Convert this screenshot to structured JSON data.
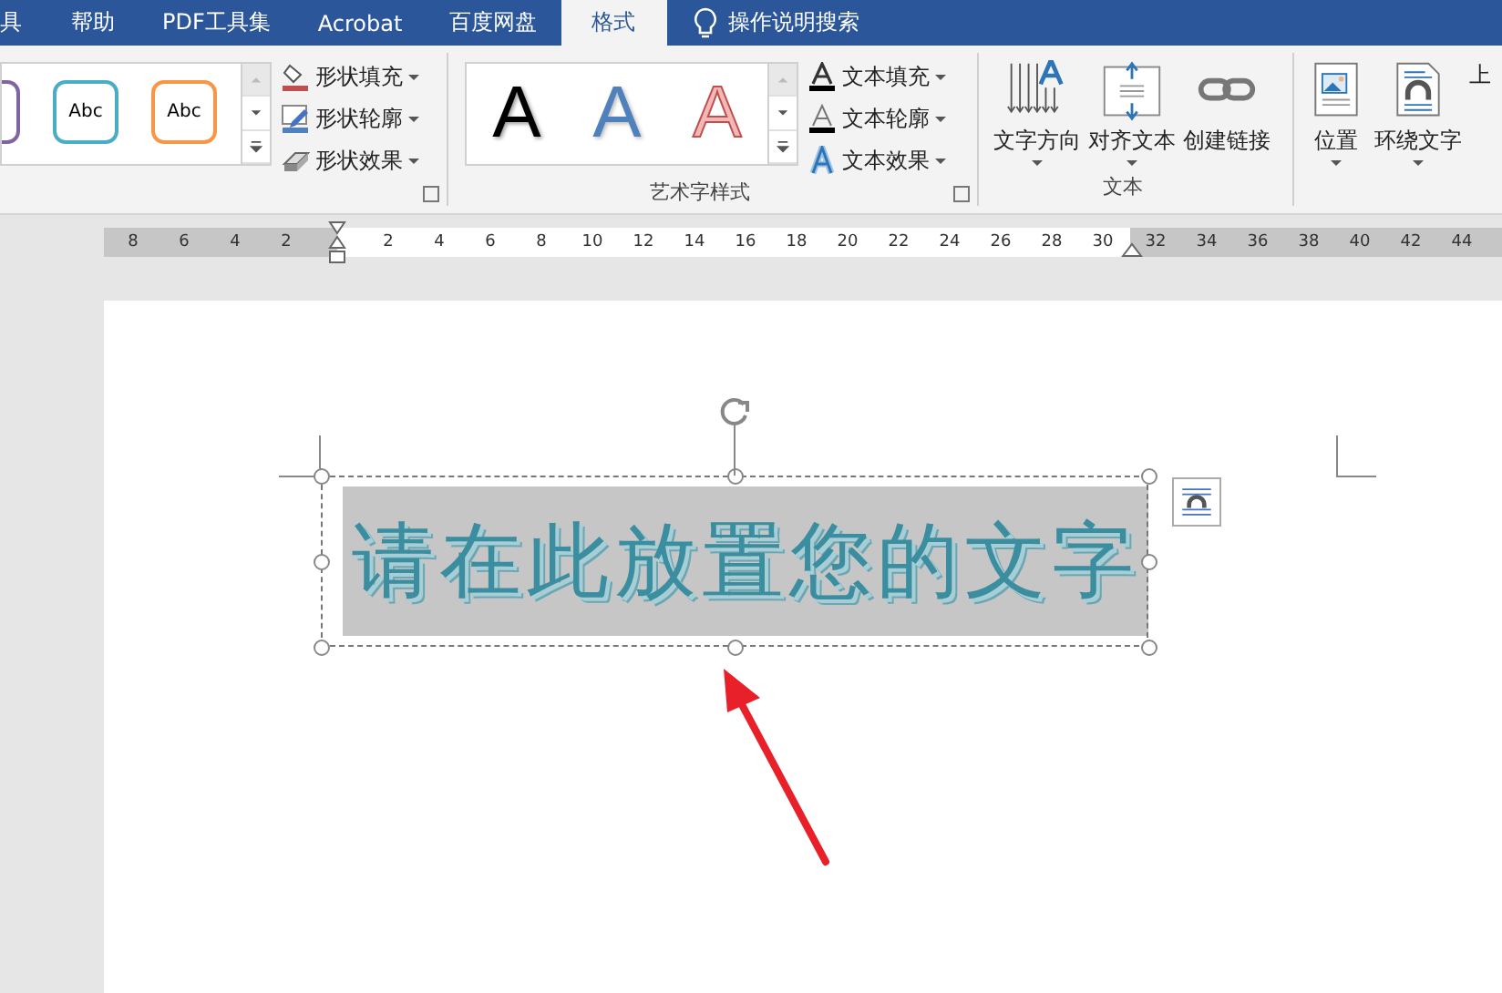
{
  "tabs": [
    {
      "label": "具",
      "selected": false
    },
    {
      "label": "帮助",
      "selected": false
    },
    {
      "label": "PDF工具集",
      "selected": false
    },
    {
      "label": "Acrobat",
      "selected": false
    },
    {
      "label": "百度网盘",
      "selected": false
    },
    {
      "label": "格式",
      "selected": true
    }
  ],
  "tell_me": "操作说明搜索",
  "shape_styles": {
    "swatches": [
      {
        "color": "#8064a2"
      },
      {
        "label": "Abc",
        "color": "#4bacc6"
      },
      {
        "label": "Abc",
        "color": "#f79646"
      }
    ],
    "commands": [
      {
        "kind": "fill",
        "label": "形状填充"
      },
      {
        "kind": "outline",
        "label": "形状轮廓"
      },
      {
        "kind": "effects",
        "label": "形状效果"
      }
    ]
  },
  "wordart_styles": {
    "label": "艺术字样式",
    "presets": [
      {
        "kind": "black",
        "label": "A"
      },
      {
        "kind": "blue",
        "label": "A"
      },
      {
        "kind": "red-outline",
        "label": "A"
      }
    ],
    "commands": [
      {
        "kind": "fill",
        "label": "文本填充"
      },
      {
        "kind": "outline",
        "label": "文本轮廓"
      },
      {
        "kind": "effects",
        "label": "文本效果"
      }
    ]
  },
  "text_group": {
    "label": "文本",
    "buttons": [
      {
        "kind": "direction",
        "label": "文字方向",
        "dropdown": true
      },
      {
        "kind": "align",
        "label": "对齐文本",
        "dropdown": true
      },
      {
        "kind": "link",
        "label": "创建链接",
        "dropdown": false
      }
    ]
  },
  "arrange_group": {
    "buttons": [
      {
        "kind": "position",
        "label": "位置",
        "dropdown": true
      },
      {
        "kind": "wrap",
        "label": "环绕文字",
        "dropdown": true
      },
      {
        "kind": "cut",
        "label": "上"
      }
    ]
  },
  "ruler": {
    "left_labels": [
      "8",
      "6",
      "4",
      "2"
    ],
    "body_labels": [
      "2",
      "4",
      "6",
      "8",
      "10",
      "12",
      "14",
      "16",
      "18",
      "20",
      "22",
      "24",
      "26",
      "28",
      "30"
    ],
    "right_labels": [
      "32",
      "34",
      "36",
      "38",
      "40",
      "42",
      "44"
    ]
  },
  "document": {
    "text_box": "请在此放置您的文字"
  }
}
